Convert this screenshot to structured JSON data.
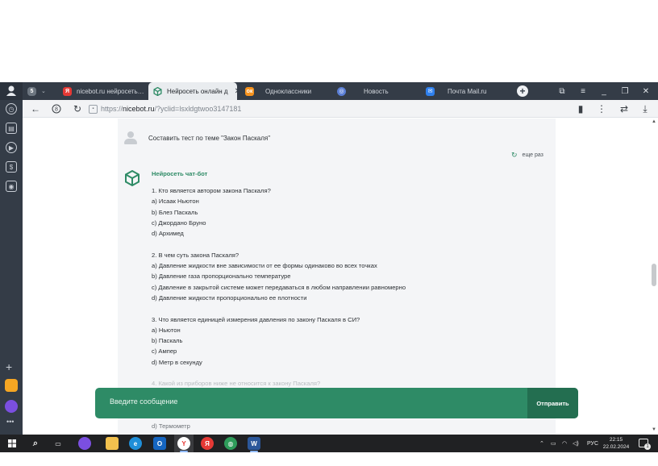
{
  "browser": {
    "tabs": [
      {
        "label": "nicebot.ru нейросеть…",
        "icon": "yandex-icon",
        "color": "#e53935",
        "active": false
      },
      {
        "label": "Нейросеть онлайн д",
        "icon": "cube-icon",
        "color": "#2e8b66",
        "active": true
      },
      {
        "label": "Одноклассники",
        "icon": "ok-icon",
        "color": "#f7931e",
        "active": false
      },
      {
        "label": "Новость",
        "icon": "globe-icon",
        "color": "#5b7fd6",
        "active": false
      },
      {
        "label": "Почта Mail.ru",
        "icon": "mail-icon",
        "color": "#2f80ed",
        "active": false
      }
    ],
    "profile_badge": "5",
    "url": {
      "scheme": "https://",
      "host": "nicebot.ru",
      "path": "/?yclid=lsxldgtwoo3147181"
    }
  },
  "chat": {
    "user_message": "Составить тест по теме \"Закон Паскаля\"",
    "regenerate_label": "еще раз",
    "bot_name": "Нейросеть чат-бот",
    "answer": [
      [
        "1. Кто является автором закона Паскаля?",
        "a) Исаак Ньютон",
        "b) Блез Паскаль",
        "c) Джордано Бруно",
        "d) Архимед"
      ],
      [
        "2. В чем суть закона Паскаля?",
        "a) Давление жидкости вне зависимости от ее формы одинаково во всех точках",
        "b) Давление газа пропорционально температуре",
        "c) Давление в закрытой системе может передаваться в любом направлении равномерно",
        "d) Давление жидкости пропорционально ее плотности"
      ],
      [
        "3. Что является единицей измерения давления по закону Паскаля в СИ?",
        "a) Ньютон",
        "b) Паскаль",
        "c) Ампер",
        "d) Метр в секунду"
      ]
    ],
    "faded_question": "4. Какой из приборов ниже не относится к закону Паскаля?",
    "bottom_line": "d) Термометр",
    "composer_placeholder": "Введите сообщение",
    "send_label": "Отправить"
  },
  "taskbar": {
    "language": "РУС",
    "time": "22:15",
    "date": "22.02.2024",
    "notification_count": "1"
  }
}
